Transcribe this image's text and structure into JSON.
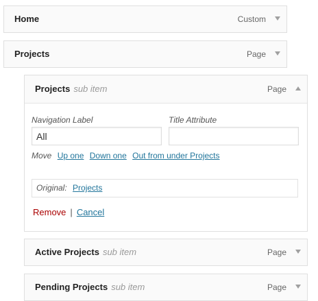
{
  "menu_items": [
    {
      "title": "Home",
      "sub_label": "",
      "type": "Custom"
    },
    {
      "title": "Projects",
      "sub_label": "",
      "type": "Page"
    },
    {
      "title": "Projects",
      "sub_label": "sub item",
      "type": "Page"
    },
    {
      "title": "Active Projects",
      "sub_label": "sub item",
      "type": "Page"
    },
    {
      "title": "Pending Projects",
      "sub_label": "sub item",
      "type": "Page"
    }
  ],
  "settings": {
    "nav_label": {
      "label": "Navigation Label",
      "value": "All"
    },
    "title_attr": {
      "label": "Title Attribute",
      "value": ""
    },
    "move": {
      "label": "Move",
      "links": [
        "Up one",
        "Down one",
        "Out from under Projects"
      ]
    },
    "original": {
      "label": "Original:",
      "link": "Projects"
    },
    "actions": {
      "remove": "Remove",
      "separator": "|",
      "cancel": "Cancel"
    }
  },
  "icons": {
    "collapsed": "arrow-down-icon",
    "expanded": "arrow-up-icon"
  },
  "colors": {
    "link": "#21759b",
    "remove": "#aa0000",
    "border": "#dfdfdf"
  }
}
